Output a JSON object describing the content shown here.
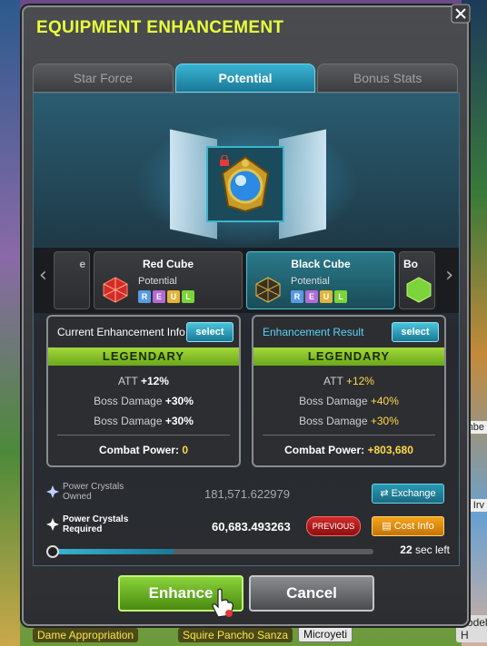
{
  "window": {
    "title": "EQUIPMENT ENHANCEMENT"
  },
  "tabs": [
    {
      "label": "Star Force",
      "active": false
    },
    {
      "label": "Potential",
      "active": true
    },
    {
      "label": "Bonus Stats",
      "active": false
    }
  ],
  "cubes": {
    "left_partial": "e",
    "items": [
      {
        "name": "Red Cube",
        "sub": "Potential",
        "selected": false
      },
      {
        "name": "Black Cube",
        "sub": "Potential",
        "selected": true
      }
    ],
    "right_partial": "Bo",
    "tiers": [
      "R",
      "E",
      "U",
      "L"
    ]
  },
  "current": {
    "header": "Current Enhancement Info",
    "select_label": "select",
    "grade": "LEGENDARY",
    "stats": [
      {
        "name": "ATT",
        "value": "+12%"
      },
      {
        "name": "Boss Damage",
        "value": "+30%"
      },
      {
        "name": "Boss Damage",
        "value": "+30%"
      }
    ],
    "combat_label": "Combat Power:",
    "combat_value": "0"
  },
  "result": {
    "header": "Enhancement Result",
    "select_label": "select",
    "grade": "LEGENDARY",
    "stats": [
      {
        "name": "ATT",
        "value": "+12%"
      },
      {
        "name": "Boss Damage",
        "value": "+40%"
      },
      {
        "name": "Boss Damage",
        "value": "+30%"
      }
    ],
    "combat_label": "Combat Power:",
    "combat_value": "+803,680"
  },
  "crystals": {
    "owned_label_1": "Power Crystals",
    "owned_label_2": "Owned",
    "owned_value": "181,571.622979",
    "exchange_label": "Exchange",
    "required_label_1": "Power Crystals",
    "required_label_2": "Required",
    "required_value": "60,683.493263",
    "previous_label": "PREVIOUS",
    "cost_label": "Cost Info"
  },
  "timer": {
    "value": "22",
    "unit": "sec left",
    "progress": 0.38
  },
  "buttons": {
    "enhance": "Enhance",
    "cancel": "Cancel"
  },
  "scene_names": [
    "Dame Appropriation",
    "Squire Pancho Sanza",
    "Microyeti",
    "Yodeling H"
  ],
  "scene_tags": [
    "mbe",
    "Irv"
  ],
  "colors": {
    "accent": "#3ab4d4",
    "title": "#e8ff3a",
    "legendary": "#a4d83a",
    "gain": "#ffd84a"
  }
}
